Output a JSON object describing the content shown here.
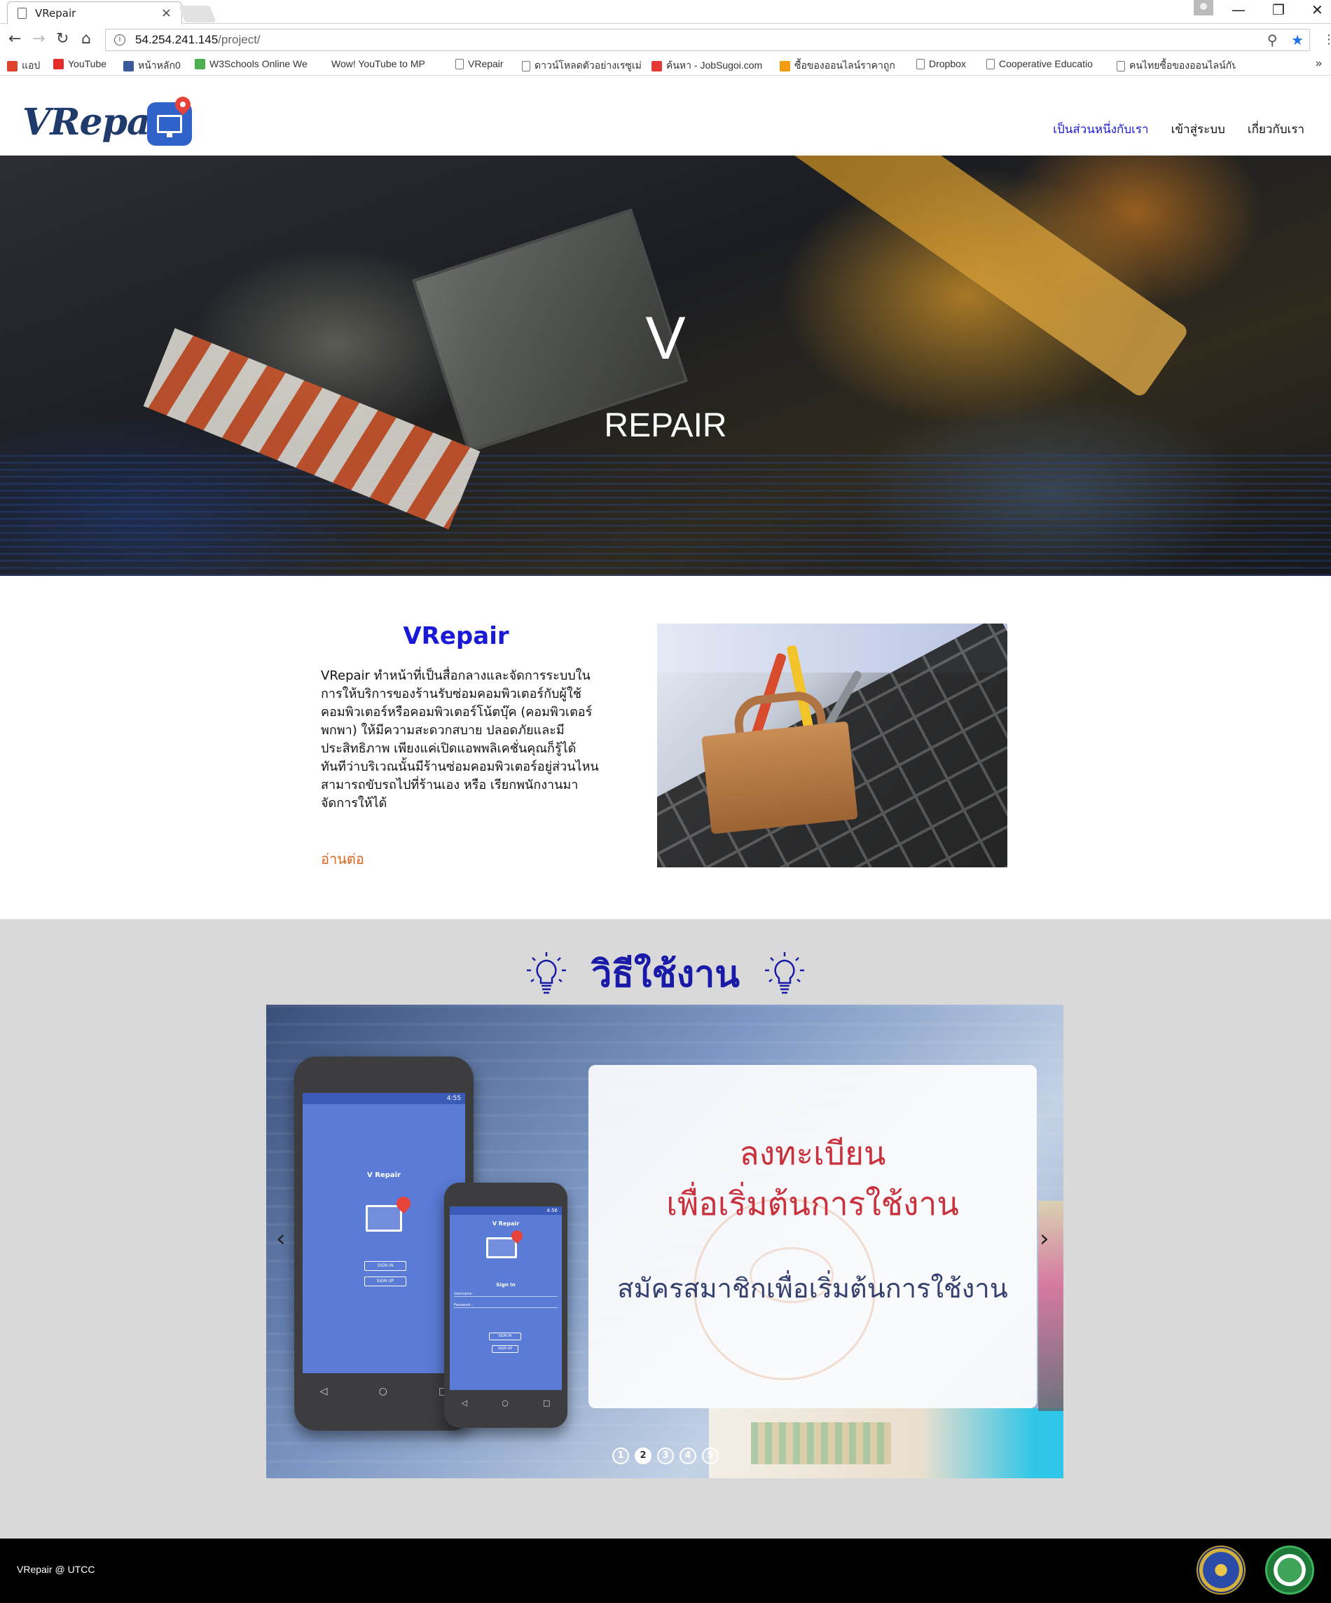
{
  "browser": {
    "tab_title": "VRepair",
    "tab_close": "×",
    "url_host": "54.254.241.145",
    "url_path": "/project/",
    "window_min": "—",
    "window_restore": "❐",
    "window_close": "✕",
    "bookmarks": [
      {
        "label": "แอป",
        "icon": "apps-grid-icon",
        "color": "#e0442f"
      },
      {
        "label": "YouTube",
        "icon": "youtube-icon",
        "color": "#e52d27"
      },
      {
        "label": "หน้าหลัก0",
        "icon": "facebook-icon",
        "color": "#3b5998"
      },
      {
        "label": "W3Schools Online We",
        "icon": "w3schools-icon",
        "color": "#4caf50"
      },
      {
        "label": "Wow! YouTube to MP",
        "icon": "blank-icon",
        "color": "#ffffff"
      },
      {
        "label": "VRepair",
        "icon": "page-icon",
        "color": "#ffffff"
      },
      {
        "label": "ดาวน์โหลดตัวอย่างเรซูเม่",
        "icon": "page-icon",
        "color": "#ffffff"
      },
      {
        "label": "ค้นหา - JobSugoi.com",
        "icon": "jobsugoi-icon",
        "color": "#e53935"
      },
      {
        "label": "ซื้อของออนไลน์ราคาถูก",
        "icon": "lazada-icon",
        "color": "#f39c12"
      },
      {
        "label": "Dropbox",
        "icon": "page-icon",
        "color": "#ffffff"
      },
      {
        "label": "Cooperative Educatio",
        "icon": "page-icon",
        "color": "#ffffff"
      },
      {
        "label": "คนไทยซื้อของออนไลน์กัน",
        "icon": "page-icon",
        "color": "#ffffff"
      }
    ],
    "bookmarks_more": "»"
  },
  "site": {
    "logo_text": "VRepair",
    "nav": [
      {
        "label": "เป็นส่วนหนึ่งกับเรา",
        "active": true
      },
      {
        "label": "เข้าสู่ระบบ",
        "active": false
      },
      {
        "label": "เกี่ยวกับเรา",
        "active": false
      }
    ],
    "accent_color": "#1a1ad6"
  },
  "hero": {
    "title": "V",
    "subtitle": "REPAIR"
  },
  "about": {
    "title": "VRepair",
    "body": "VRepair ทำหน้าที่เป็นสื่อกลางและจัดการระบบในการให้บริการของร้านรับซ่อมคอมพิวเตอร์กับผู้ใช้คอมพิวเตอร์หรือคอมพิวเตอร์โน้ตบุ๊ค (คอมพิวเตอร์พกพา) ให้มีความสะดวกสบาย ปลอดภัยและมีประสิทธิภาพ เพียงแค่เปิดแอพพลิเคชั่นคุณก็รู้ได้ทันทีว่าบริเวณนั้นมีร้านซ่อมคอมพิวเตอร์อยู่ส่วนไหน สามารถขับรถไปที่ร้านเอง หรือ เรียกพนักงานมาจัดการให้ได้",
    "read_more": "อ่านต่อ"
  },
  "howto": {
    "title": "วิธีใช้งาน",
    "slide": {
      "headline_line1": "ลงทะเบียน",
      "headline_line2": "เพื่อเริ่มต้นการใช้งาน",
      "subtitle": "สมัครสมาชิกเพื่อเริ่มต้นการใช้งาน",
      "phone_large": {
        "time": "4:55",
        "app_title": "V Repair",
        "btn_signin": "SIGN IN",
        "btn_signup": "SIGN UP"
      },
      "phone_small": {
        "time": "4:56",
        "app_title": "V Repair",
        "form_title": "Sign In",
        "username_label": "Username :",
        "password_label": "Password :",
        "btn_signin": "SIGN IN",
        "btn_signup": "SIGN UP"
      }
    },
    "prev": "‹",
    "next": "›",
    "dots": [
      "1",
      "2",
      "3",
      "4",
      "5"
    ],
    "active_dot": 1
  },
  "footer": {
    "text": "VRepair @ UTCC"
  }
}
